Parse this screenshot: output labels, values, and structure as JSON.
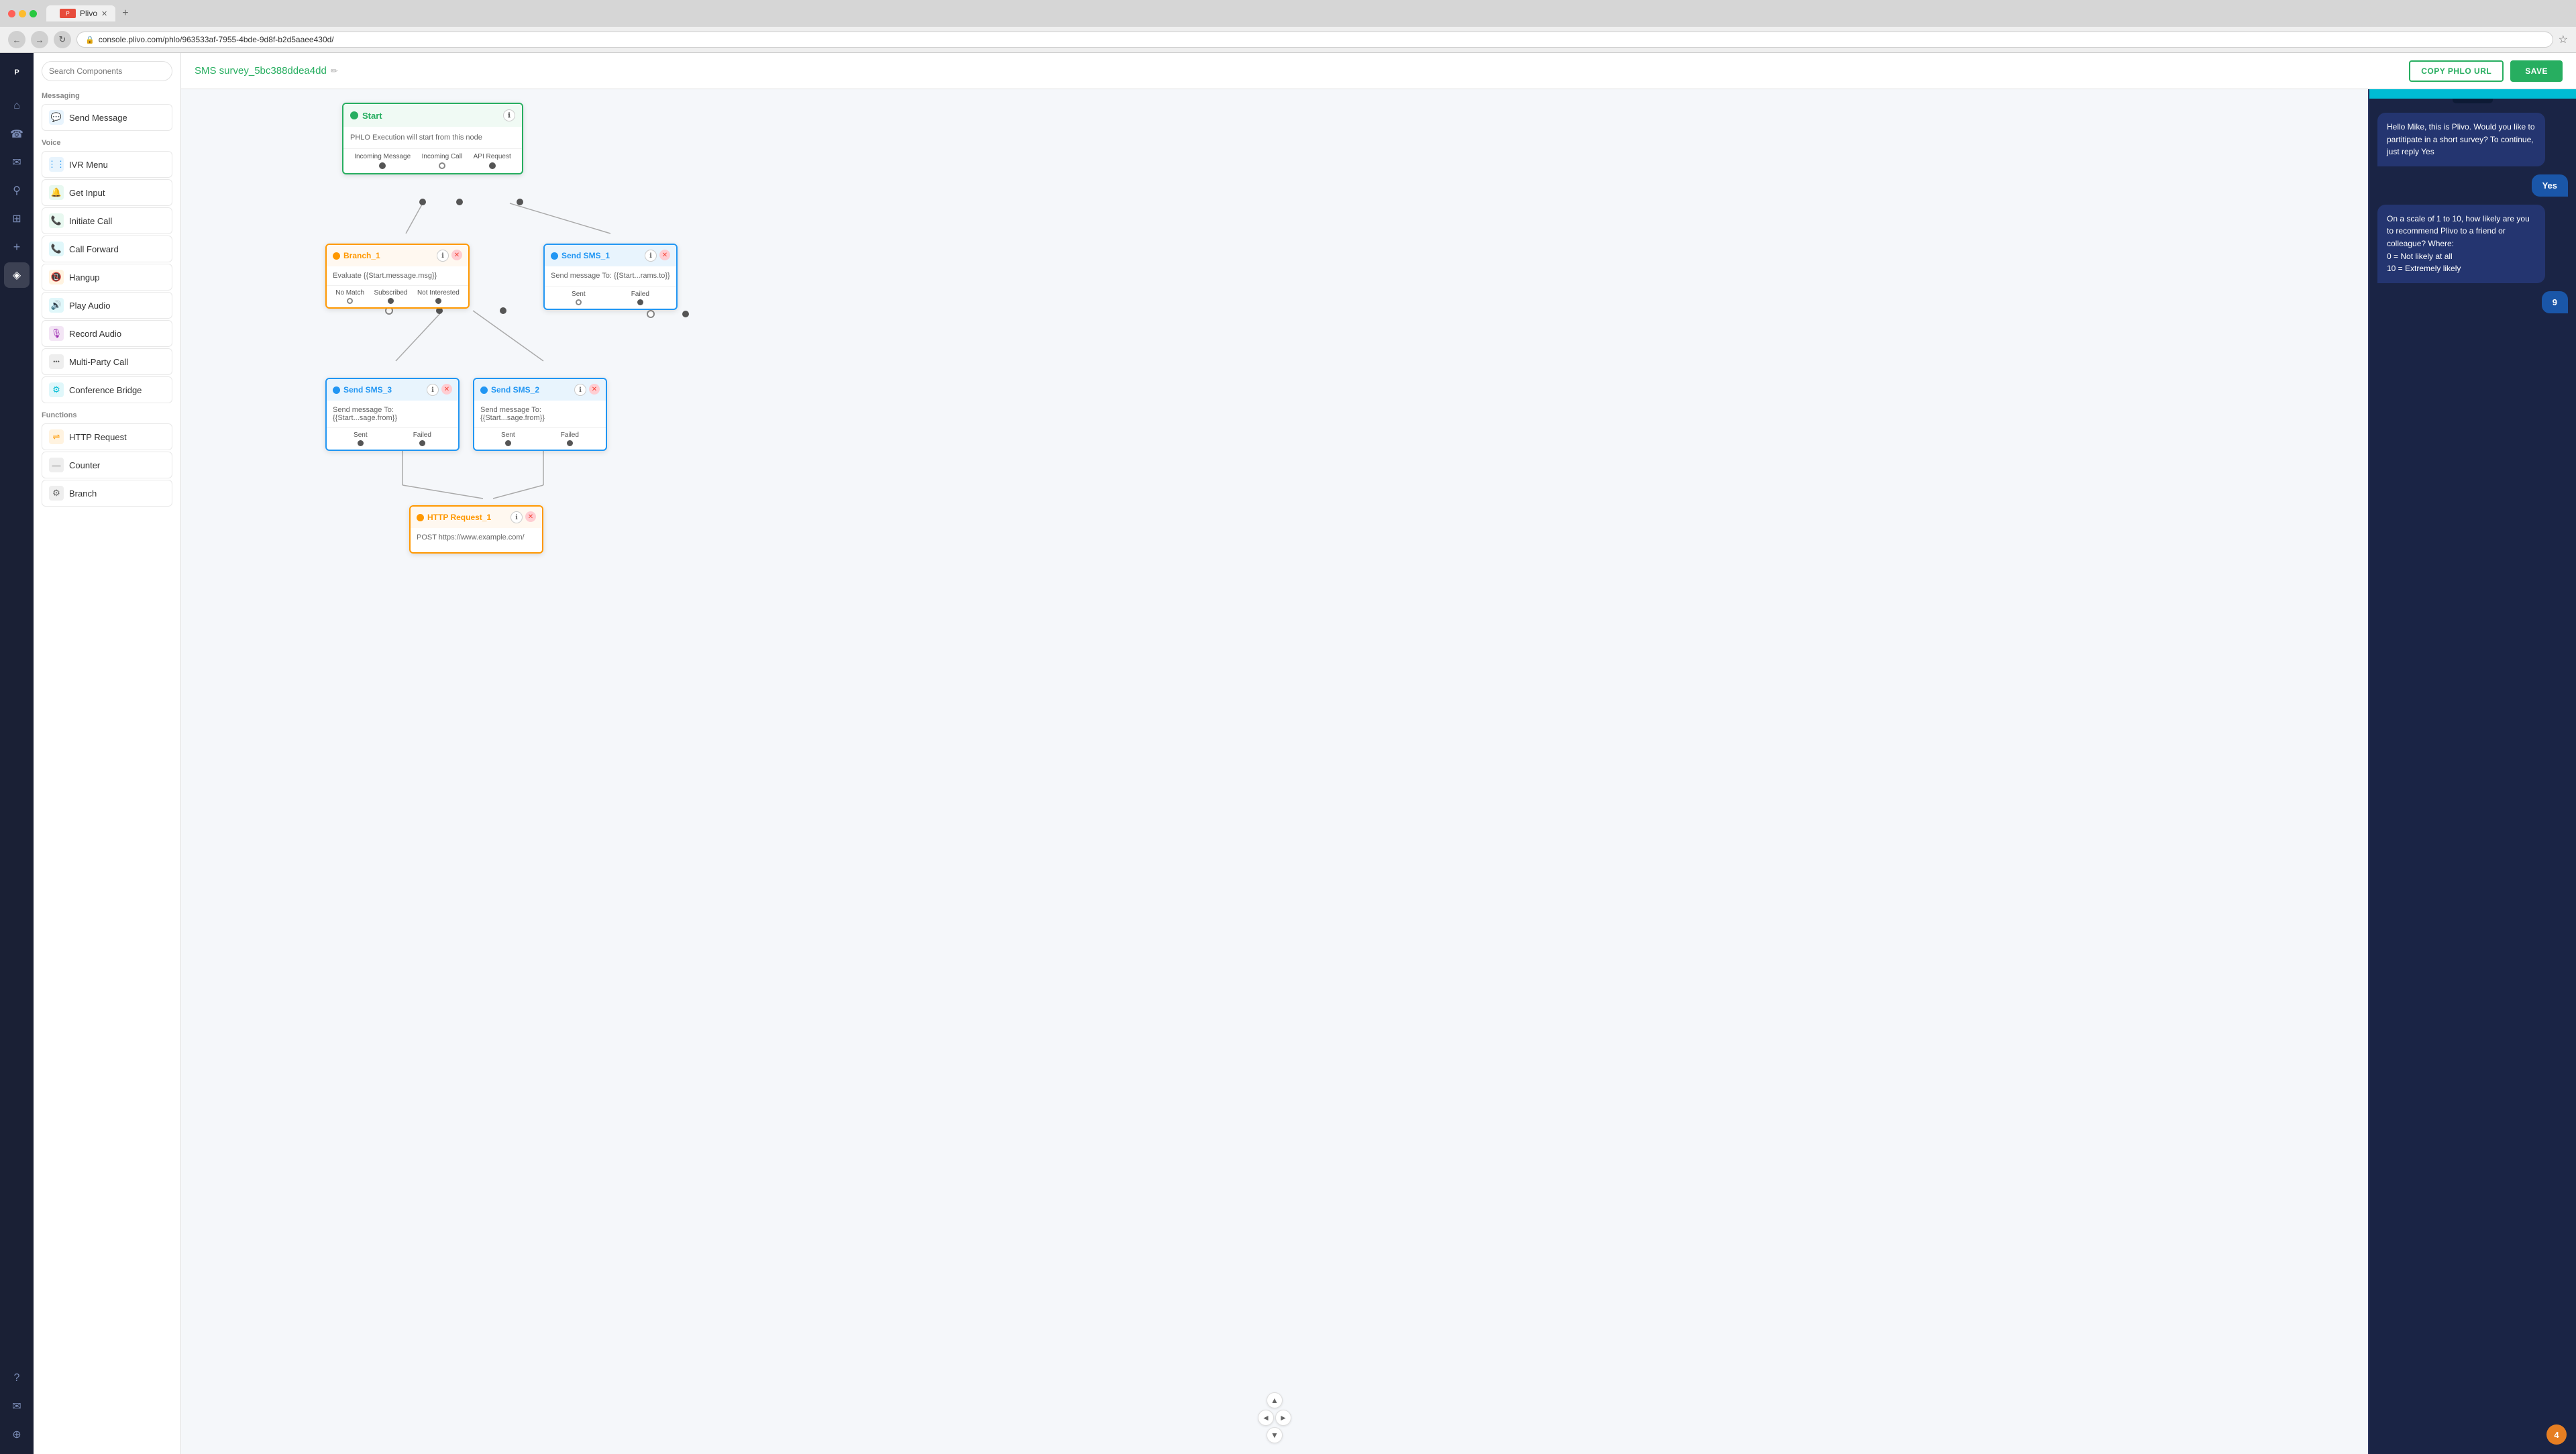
{
  "browser": {
    "tab_title": "Plivo",
    "url": "console.plivo.com/phlo/963533af-7955-4bde-9d8f-b2d5aaee430d/",
    "new_tab_label": "+",
    "nav": {
      "back": "←",
      "forward": "→",
      "refresh": "↻"
    }
  },
  "header": {
    "title": "SMS survey_5bc388ddea4dd",
    "edit_icon": "✏",
    "copy_btn": "COPY PHLO URL",
    "save_btn": "SAVE"
  },
  "sidebar": {
    "icons": [
      {
        "name": "home",
        "symbol": "⌂",
        "active": false
      },
      {
        "name": "phone",
        "symbol": "📞",
        "active": false
      },
      {
        "name": "message",
        "symbol": "✉",
        "active": false
      },
      {
        "name": "search",
        "symbol": "🔍",
        "active": false
      },
      {
        "name": "grid",
        "symbol": "⊞",
        "active": false
      },
      {
        "name": "plus",
        "symbol": "+",
        "active": false
      },
      {
        "name": "flow",
        "symbol": "◈",
        "active": true
      },
      {
        "name": "help",
        "symbol": "?",
        "active": false
      },
      {
        "name": "mail",
        "symbol": "✉",
        "active": false
      },
      {
        "name": "globe",
        "symbol": "🌐",
        "active": false
      }
    ]
  },
  "components": {
    "search_placeholder": "Search Components",
    "sections": [
      {
        "label": "Messaging",
        "items": [
          {
            "id": "send-message",
            "label": "Send Message",
            "icon": "💬",
            "color": "blue"
          }
        ]
      },
      {
        "label": "Voice",
        "items": [
          {
            "id": "ivr-menu",
            "label": "IVR Menu",
            "icon": "⋮⋮",
            "color": "blue"
          },
          {
            "id": "get-input",
            "label": "Get Input",
            "icon": "🔔",
            "color": "green"
          },
          {
            "id": "initiate-call",
            "label": "Initiate Call",
            "icon": "📞",
            "color": "green"
          },
          {
            "id": "call-forward",
            "label": "Call Forward",
            "icon": "📞",
            "color": "teal"
          },
          {
            "id": "hangup",
            "label": "Hangup",
            "icon": "📵",
            "color": "orange"
          },
          {
            "id": "play-audio",
            "label": "Play Audio",
            "icon": "🔊",
            "color": "teal"
          },
          {
            "id": "record-audio",
            "label": "Record Audio",
            "icon": "🎙",
            "color": "purple"
          },
          {
            "id": "multi-party-call",
            "label": "Multi-Party Call",
            "icon": "•••",
            "color": "dark"
          },
          {
            "id": "conference-bridge",
            "label": "Conference Bridge",
            "icon": "⚙",
            "color": "teal"
          }
        ]
      },
      {
        "label": "Functions",
        "items": [
          {
            "id": "http-request",
            "label": "HTTP Request",
            "icon": "⇌",
            "color": "orange"
          },
          {
            "id": "counter",
            "label": "Counter",
            "icon": "—",
            "color": "dark"
          },
          {
            "id": "branch",
            "label": "Branch",
            "icon": "⚙",
            "color": "dark"
          }
        ]
      }
    ]
  },
  "nodes": {
    "start": {
      "title": "Start",
      "description": "PHLO Execution will start from this node",
      "ports": [
        "Incoming Message",
        "Incoming Call",
        "API Request"
      ]
    },
    "branch_1": {
      "title": "Branch_1",
      "body": "Evaluate {{Start.message.msg}}",
      "ports": [
        "No Match",
        "Subscribed",
        "Not Interested"
      ]
    },
    "send_sms_1": {
      "title": "Send SMS_1",
      "body": "Send message To: {{Start...rams.to}}",
      "ports": [
        "Sent",
        "Failed"
      ]
    },
    "send_sms_3": {
      "title": "Send SMS_3",
      "body": "Send message To: {{Start...sage.from}}",
      "ports": [
        "Sent",
        "Failed"
      ]
    },
    "send_sms_2": {
      "title": "Send SMS_2",
      "body": "Send message To: {{Start...sage.from}}",
      "ports": [
        "Sent",
        "Failed"
      ]
    },
    "http_request_1": {
      "title": "HTTP Request_1",
      "body": "POST https://www.example.com/",
      "ports": []
    }
  },
  "phone": {
    "messages": [
      {
        "side": "left",
        "text": "Hello Mike, this is Plivo. Would you like to partitipate in a short survey? To continue, just reply Yes"
      },
      {
        "side": "right",
        "text": "Yes"
      },
      {
        "side": "left",
        "text": "On a scale of 1 to 10, how likely are you to recommend Plivo to a friend or colleague? Where:\n0 = Not likely at all\n10 = Extremely likely"
      },
      {
        "side": "right",
        "text": "9"
      }
    ],
    "avatar_label": "4"
  },
  "canvas_nav": {
    "left": "‹",
    "up": "↑",
    "right": "›",
    "down": "↓"
  }
}
